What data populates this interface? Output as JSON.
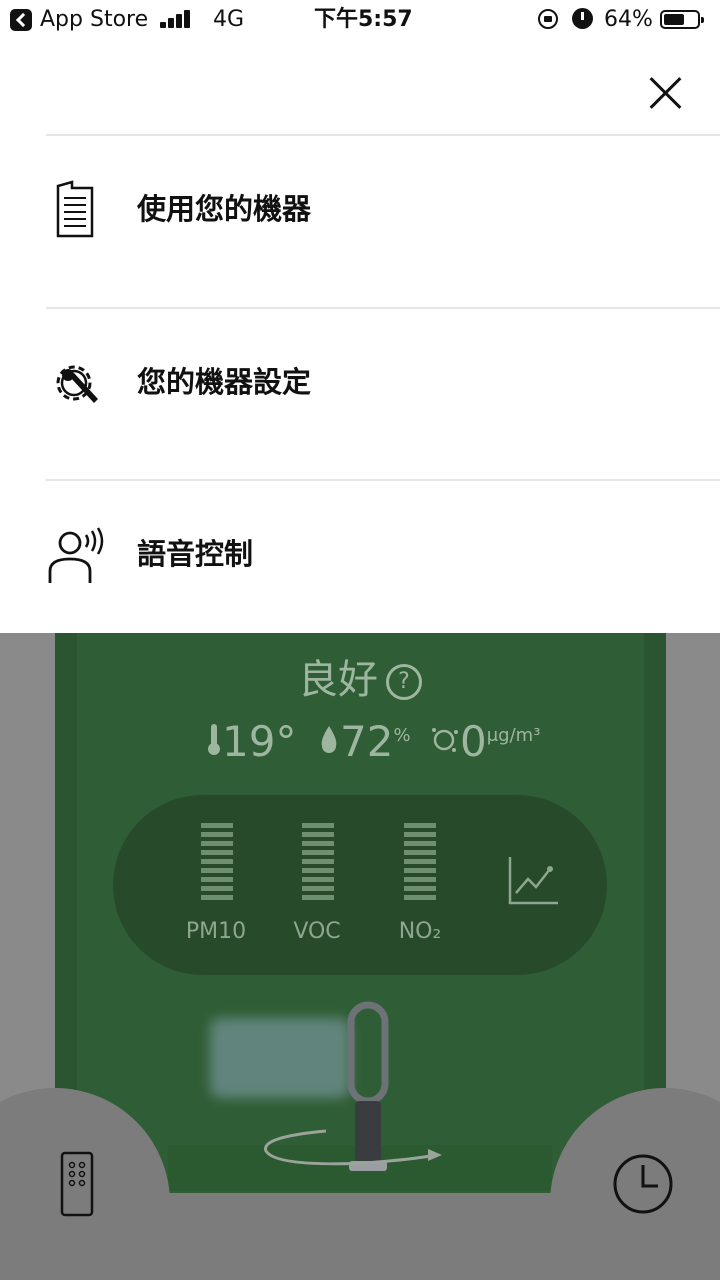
{
  "status_bar": {
    "back_app": "App Store",
    "network": "4G",
    "time": "下午5:57",
    "battery_text": "64%",
    "battery_level": 0.64
  },
  "menu": {
    "items": [
      {
        "label": "使用您的機器",
        "icon": "manual-icon"
      },
      {
        "label": "您的機器設定",
        "icon": "settings-wrench-icon"
      },
      {
        "label": "語音控制",
        "icon": "voice-control-icon"
      }
    ]
  },
  "background_app": {
    "air_quality": "良好",
    "help_symbol": "?",
    "temperature": "19°",
    "humidity": "72",
    "humidity_unit": "%",
    "particles": "0",
    "particles_unit": "μg/m³",
    "meters": [
      {
        "label": "PM10"
      },
      {
        "label": "VOC"
      },
      {
        "label": "NO₂"
      }
    ]
  }
}
